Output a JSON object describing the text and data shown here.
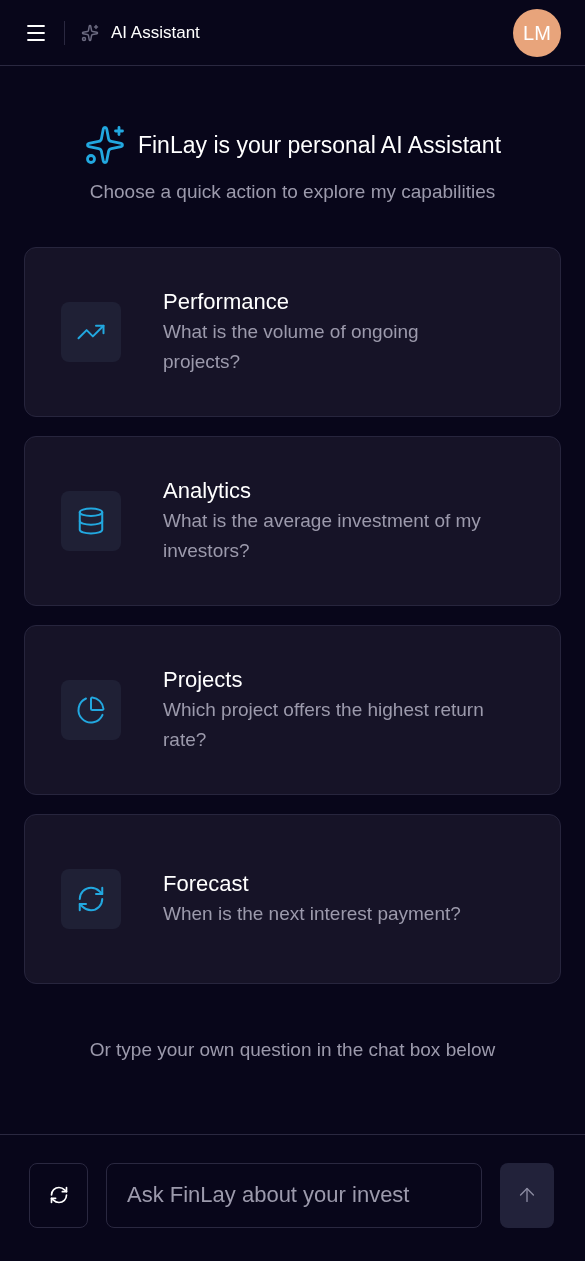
{
  "header": {
    "title": "AI Assistant",
    "avatar": "LM"
  },
  "intro": {
    "title": "FinLay is your personal AI Assistant",
    "subtitle": "Choose a quick action to explore my capabilities"
  },
  "actions": [
    {
      "kind": "trend",
      "title": "Performance",
      "question": "What is the volume of ongoing projects?"
    },
    {
      "kind": "database",
      "title": "Analytics",
      "question": "What is the average investment of my investors?"
    },
    {
      "kind": "pie",
      "title": "Projects",
      "question": "Which project offers the highest return rate?"
    },
    {
      "kind": "refresh",
      "title": "Forecast",
      "question": "When is the next interest payment?"
    }
  ],
  "hint": "Or type your own question in the chat box below",
  "composer": {
    "placeholder": "Ask FinLay about your invest"
  }
}
